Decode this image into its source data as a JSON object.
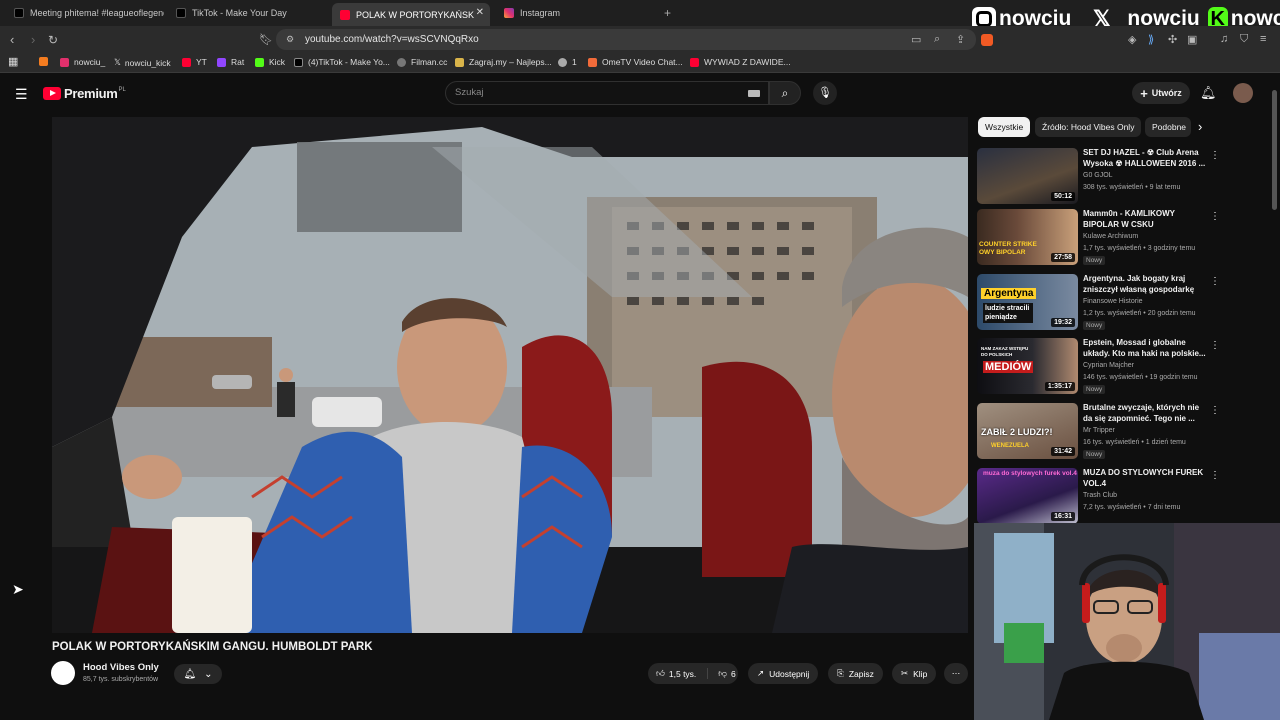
{
  "tabs": [
    {
      "label": "Meeting phitema! #leagueoflegends",
      "favicon": "tiktok-icon",
      "color": "#222222"
    },
    {
      "label": "TikTok - Make Your Day",
      "favicon": "tiktok-icon",
      "color": "#222222"
    },
    {
      "label": "POLAK W PORTORYKAŃSKIM",
      "favicon": "youtube-icon",
      "color": "#ff0033",
      "active": true
    },
    {
      "label": "Instagram",
      "favicon": "instagram-icon",
      "color": "#e1306c"
    }
  ],
  "address": {
    "url": "youtube.com/watch?v=wsSCVNQqRxo"
  },
  "bookmarks": [
    {
      "label": "",
      "icon": "feed-icon",
      "color": "#f47c20"
    },
    {
      "label": "nowciu_",
      "icon": "instagram-icon",
      "color": "#e1306c"
    },
    {
      "label": "nowciu_kick",
      "icon": "x-icon",
      "color": "#ffffff"
    },
    {
      "label": "YT",
      "icon": "youtube-icon",
      "color": "#ff0033"
    },
    {
      "label": "Rat",
      "icon": "twitch-icon",
      "color": "#9146ff"
    },
    {
      "label": "Kick",
      "icon": "kick-icon",
      "color": "#53fc18"
    },
    {
      "label": "(4)TikTok - Make Yo...",
      "icon": "tiktok-icon",
      "color": "#ffffff"
    },
    {
      "label": "Filman.cc",
      "icon": "filman-icon",
      "color": "#888888"
    },
    {
      "label": "Zagraj.my – Najleps...",
      "icon": "person-icon",
      "color": "#d9b44a"
    },
    {
      "label": "1",
      "icon": "globe-icon",
      "color": "#aaaaaa"
    },
    {
      "label": "OmeTV Video Chat...",
      "icon": "ometv-icon",
      "color": "#f26b3a"
    },
    {
      "label": "WYWIAD Z DAWIDE...",
      "icon": "youtube-icon",
      "color": "#ff0033"
    }
  ],
  "socials": [
    {
      "handle": "nowciu_",
      "icon": "instagram-icon"
    },
    {
      "handle": "_nowciu",
      "icon": "x-icon"
    },
    {
      "handle": "nowciu",
      "icon": "kick-icon"
    }
  ],
  "youtube": {
    "logo_text": "Premium",
    "logo_region": "PL",
    "search_placeholder": "Szukaj",
    "create_label": "Utwórz"
  },
  "video": {
    "title": "POLAK W PORTORYKAŃSKIM GANGU. HUMBOLDT PARK",
    "channel": "Hood Vibes Only",
    "subscribers": "85,7 tys. subskrybentów",
    "likes": "1,5 tys.",
    "dislikes": "6",
    "share": "Udostępnij",
    "save": "Zapisz",
    "clip": "Klip"
  },
  "chips": [
    "Wszystkie",
    "Źródło: Hood Vibes Only",
    "Podobne"
  ],
  "recommendations": [
    {
      "title": "SET DJ HAZEL - ☢ Club Arena Wysoka ☢ HALLOWEEN 2016 ...",
      "channel": "G0 GJOL",
      "meta": "308 tys. wyświetleń • 9 lat temu",
      "duration": "50:12",
      "badge": "",
      "thumb": "#3a4a5a"
    },
    {
      "title": "Mamm0n - KAMLIKOWY BIPOLAR W CSKU",
      "channel": "Kulawe Archiwum",
      "meta": "1,7 tys. wyświetleń • 3 godziny temu",
      "duration": "27:58",
      "badge": "Nowy",
      "thumb": "#4a3a32"
    },
    {
      "title": "Argentyna. Jak bogaty kraj zniszczył własną gospodarkę",
      "channel": "Finansowe Historie",
      "meta": "1,2 tys. wyświetleń • 20 godzin temu",
      "duration": "19:32",
      "badge": "Nowy",
      "thumb": "#2d4a6a"
    },
    {
      "title": "Epstein, Mossad i globalne układy. Kto ma haki na polskie...",
      "channel": "Cyprian Majcher",
      "meta": "146 tys. wyświetleń • 19 godzin temu",
      "duration": "1:35:17",
      "badge": "Nowy",
      "thumb": "#1c1c22"
    },
    {
      "title": "Brutalne zwyczaje, których nie da się zapomnieć. Tego nie ...",
      "channel": "Mr Tripper",
      "meta": "16 tys. wyświetleń • 1 dzień temu",
      "duration": "31:42",
      "badge": "Nowy",
      "thumb": "#6a5040"
    },
    {
      "title": "MUZA DO STYLOWYCH FUREK VOL.4",
      "channel": "Trash Club",
      "meta": "7,2 tys. wyświetleń • 7 dni temu",
      "duration": "16:31",
      "badge": "",
      "thumb": "#4a2a6a"
    }
  ],
  "thumb_overlays": {
    "t2": "COUNTER STRIKE OWY BIPOLAR",
    "t3a": "Argentyna",
    "t3b": "ludzie stracili pieniądze",
    "t4a": "NAM ZAKAZ WSTĘPU DO POLSKICH",
    "t4b": "MEDIÓW",
    "t5a": "ZABIŁ 2 LUDZI?!",
    "t5b": "WENEZUELA",
    "t6": "muza do stylowych furek vol.4"
  }
}
